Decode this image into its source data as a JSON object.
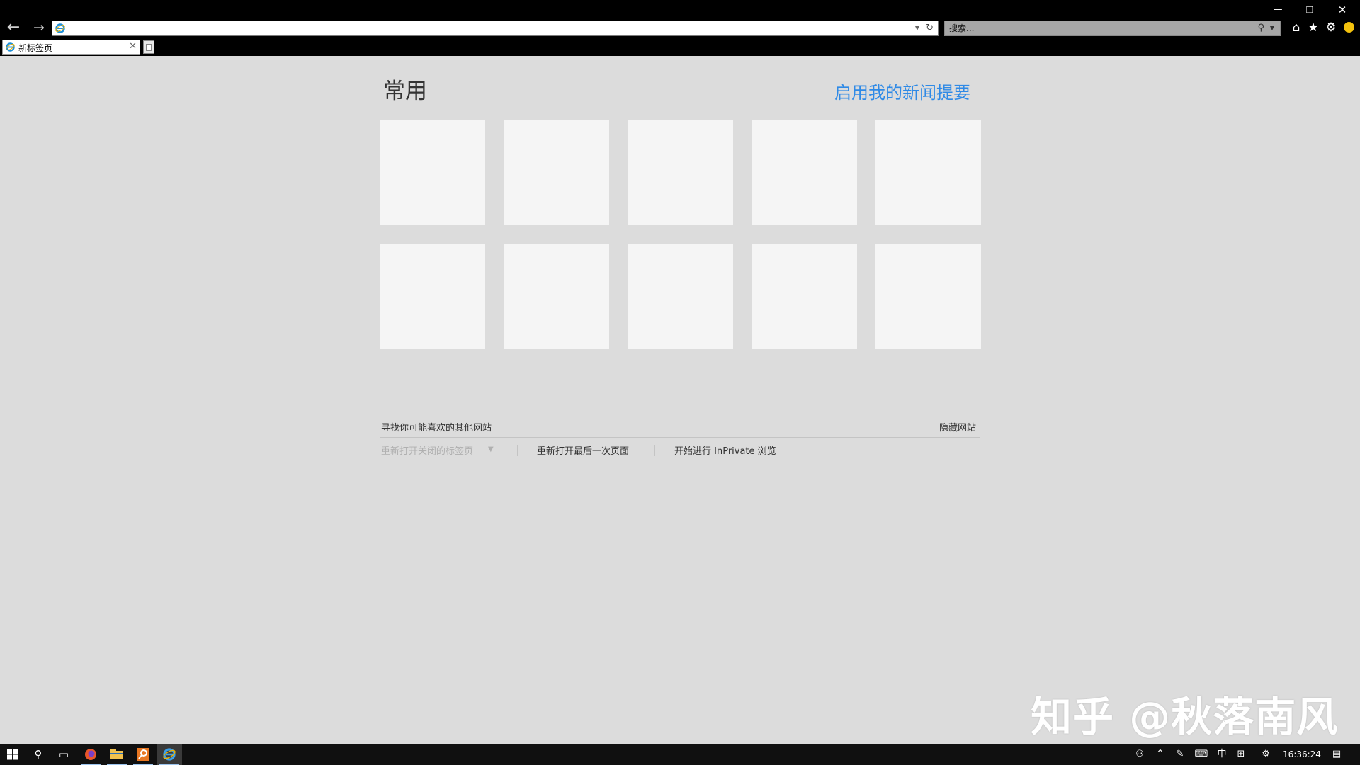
{
  "browser": {
    "address_value": "",
    "search_placeholder": "搜索...",
    "tab_label": "新标签页",
    "window_controls": {
      "minimize": "—",
      "maximize": "❐",
      "close": "✕"
    }
  },
  "page": {
    "title": "常用",
    "news_link": "启用我的新闻提要",
    "tiles_count": 10,
    "suggest_text": "寻找你可能喜欢的其他网站",
    "hide_sites": "隐藏网站",
    "reopen_closed_tabs": "重新打开关闭的标签页",
    "reopen_last_session": "重新打开最后一次页面",
    "inprivate": "开始进行 InPrivate 浏览"
  },
  "watermark": "知乎 @秋落南风",
  "taskbar": {
    "ime_label": "中",
    "clock": "16:36:24"
  },
  "colors": {
    "accent_link": "#2f8ae6",
    "page_bg": "#dcdcdc",
    "tile_bg": "#f5f5f5"
  }
}
